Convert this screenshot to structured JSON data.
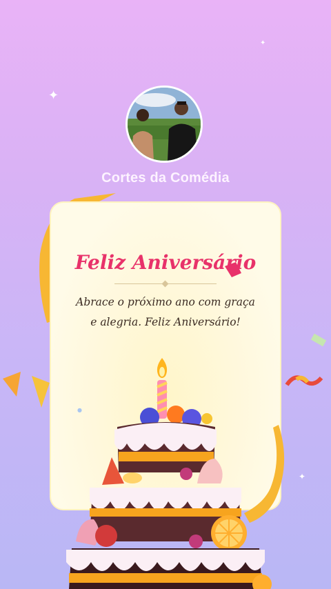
{
  "channel": {
    "name": "Cortes da Comédia"
  },
  "card": {
    "title": "Feliz Aniversário",
    "message": "Abrace o próximo ano com graça e alegria. Feliz Aniversário!"
  },
  "icons": [
    "sparkle-icon",
    "ribbon-icon",
    "confetti-icon",
    "birthday-cake-icon",
    "candle-icon"
  ],
  "colors": {
    "title": "#e8326a",
    "card": "#fff8dc",
    "background_top": "#e9b3f7",
    "background_bottom": "#b9b7f5"
  }
}
